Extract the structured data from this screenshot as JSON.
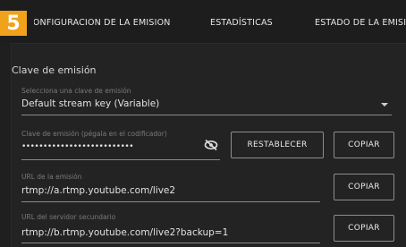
{
  "badge": "5",
  "tabs": [
    {
      "label": "CONFIGURACIÓN DE LA EMISIÓN"
    },
    {
      "label": "ESTADÍSTICAS"
    },
    {
      "label": "ESTADO DE LA EMISIÓN"
    }
  ],
  "section_title": "Clave de emisión",
  "stream_key_select": {
    "caption": "Selecciona una clave de emisión",
    "value": "Default stream key (Variable)"
  },
  "stream_key_field": {
    "caption": "Clave de emisión (pégala en el codificador)",
    "value": "••••••••••••••••••••••••••"
  },
  "stream_url": {
    "caption": "URL de la emisión",
    "value": "rtmp://a.rtmp.youtube.com/live2"
  },
  "backup_url": {
    "caption": "URL del servidor secundario",
    "value": "rtmp://b.rtmp.youtube.com/live2?backup=1"
  },
  "buttons": {
    "reset": "RESTABLECER",
    "copy_key": "COPIAR",
    "copy_url": "COPIAR",
    "copy_backup": "COPIAR"
  }
}
